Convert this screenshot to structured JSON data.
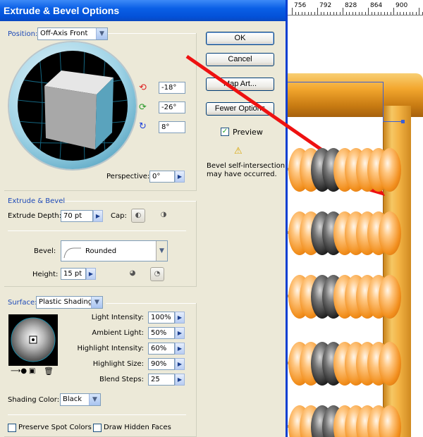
{
  "dialog": {
    "title": "Extrude & Bevel Options",
    "position_label": "Position:",
    "position_value": "Off-Axis Front",
    "rotation": {
      "x": "-18°",
      "y": "-26°",
      "z": "8°"
    },
    "perspective_label": "Perspective:",
    "perspective_value": "0°",
    "extrude_section": "Extrude & Bevel",
    "extrude_depth_label": "Extrude Depth:",
    "extrude_depth_value": "70 pt",
    "cap_label": "Cap:",
    "bevel_label": "Bevel:",
    "bevel_value": "Rounded",
    "height_label": "Height:",
    "height_value": "15 pt",
    "surface_label": "Surface:",
    "surface_value": "Plastic Shading",
    "light_intensity_label": "Light Intensity:",
    "light_intensity_value": "100%",
    "ambient_light_label": "Ambient Light:",
    "ambient_light_value": "50%",
    "highlight_intensity_label": "Highlight Intensity:",
    "highlight_intensity_value": "60%",
    "highlight_size_label": "Highlight Size:",
    "highlight_size_value": "90%",
    "blend_steps_label": "Blend Steps:",
    "blend_steps_value": "25",
    "shading_color_label": "Shading Color:",
    "shading_color_value": "Black",
    "preserve_spot_label": "Preserve Spot Colors",
    "draw_hidden_label": "Draw Hidden Faces",
    "buttons": {
      "ok": "OK",
      "cancel": "Cancel",
      "map_art": "Map Art...",
      "fewer_options": "Fewer Options"
    },
    "preview_label": "Preview",
    "preview_checked": "✓",
    "warning_text_1": "Bevel self-intersection",
    "warning_text_2": "may have occurred."
  },
  "ruler": {
    "ticks": [
      "756",
      "792",
      "828",
      "864",
      "900"
    ]
  },
  "colors": {
    "title_bar": "#0a5fe6",
    "dialog_bg": "#ece9d8",
    "section_label": "#1d49b8",
    "arrow": "#ee1111",
    "bead_orange": "#f28f1d",
    "bead_black": "#111111",
    "frame_wood": "#f3a72e"
  },
  "icons": {
    "warning": "warning-icon",
    "rotate_x": "rotate-x-icon",
    "rotate_y": "rotate-y-icon",
    "rotate_z": "rotate-z-icon"
  }
}
